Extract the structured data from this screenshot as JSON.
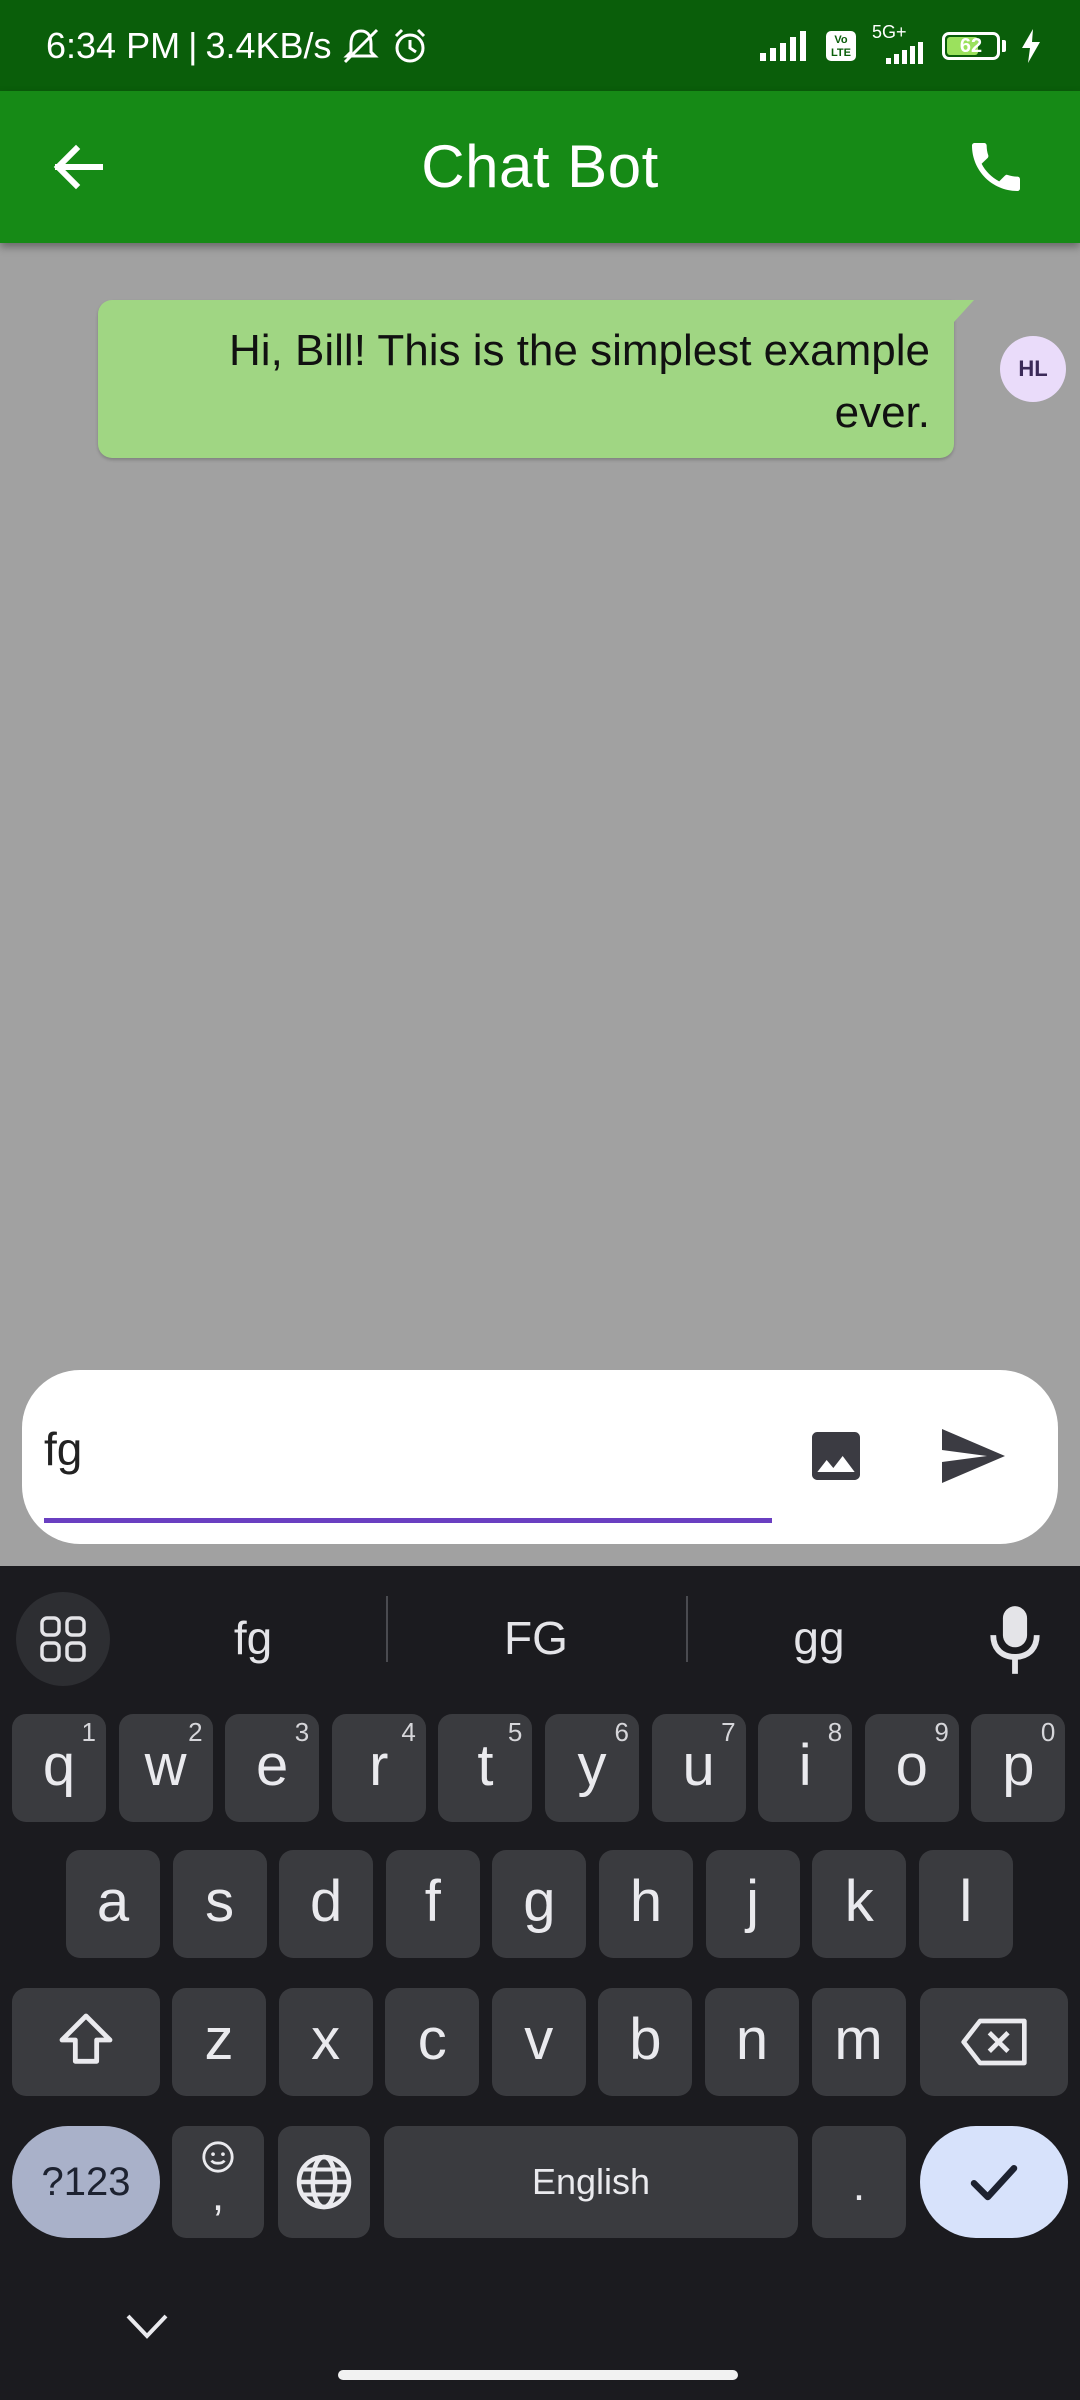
{
  "status": {
    "time": "6:34 PM",
    "speed": "3.4KB/s",
    "volte": "Vo LTE",
    "network": "5G+",
    "battery": "62"
  },
  "appbar": {
    "title": "Chat Bot",
    "color": "#168a16"
  },
  "messages": [
    {
      "text": "Hi, Bill! This is the simplest example ever.",
      "avatar": "HL",
      "bubble_color": "#a0d683"
    }
  ],
  "composer": {
    "value": "fg",
    "accent": "#6a3fc1"
  },
  "keyboard": {
    "suggestions": [
      "fg",
      "FG",
      "gg"
    ],
    "row1": [
      {
        "k": "q",
        "h": "1"
      },
      {
        "k": "w",
        "h": "2"
      },
      {
        "k": "e",
        "h": "3"
      },
      {
        "k": "r",
        "h": "4"
      },
      {
        "k": "t",
        "h": "5"
      },
      {
        "k": "y",
        "h": "6"
      },
      {
        "k": "u",
        "h": "7"
      },
      {
        "k": "i",
        "h": "8"
      },
      {
        "k": "o",
        "h": "9"
      },
      {
        "k": "p",
        "h": "0"
      }
    ],
    "row2": [
      "a",
      "s",
      "d",
      "f",
      "g",
      "h",
      "j",
      "k",
      "l"
    ],
    "row3": [
      "z",
      "x",
      "c",
      "v",
      "b",
      "n",
      "m"
    ],
    "symbols_label": "?123",
    "comma_label": ",",
    "space_label": "English",
    "period_label": "."
  }
}
